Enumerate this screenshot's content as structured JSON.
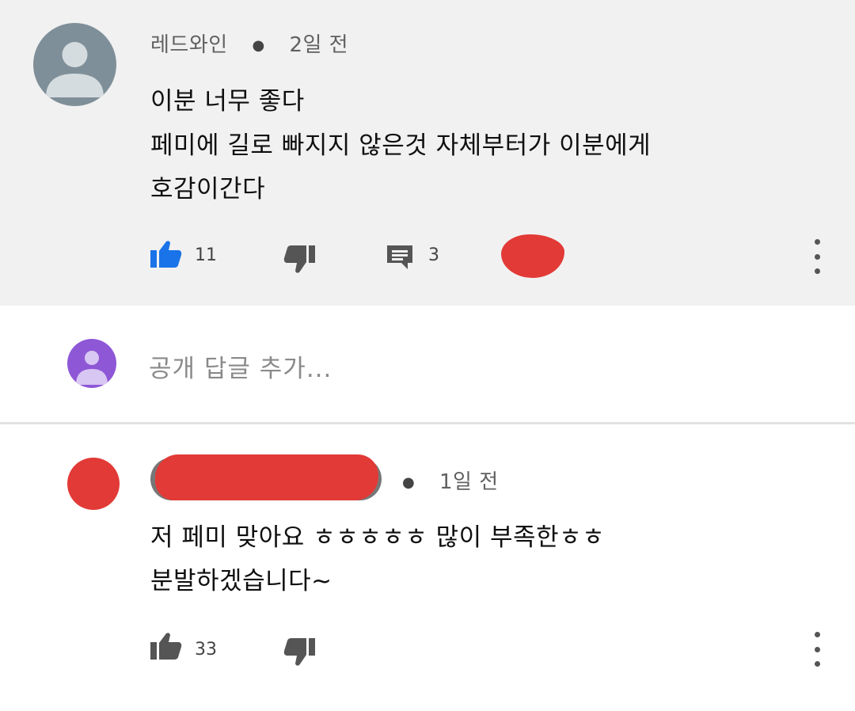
{
  "comments": [
    {
      "author": "레드와인",
      "time": "2일 전",
      "lines": [
        "이분 너무 좋다",
        "페미에 길로 빠지지 않은것 자체부터가 이분에게",
        "호감이간다"
      ],
      "likes": "11",
      "replies": "3",
      "like_active_color": "#1a73e8"
    },
    {
      "author": "",
      "time": "1일 전",
      "lines": [
        "저 페미 맞아요 ㅎㅎㅎㅎㅎ 많이 부족한ㅎㅎ",
        "분발하겠습니다~"
      ],
      "likes": "33"
    }
  ],
  "reply_box": {
    "placeholder": "공개 답글 추가..."
  },
  "colors": {
    "top_background": "#f1f1f1",
    "redaction": "#e23a36",
    "reply_avatar": "#8e57d6"
  },
  "icons": [
    "thumbs-up-icon",
    "thumbs-down-icon",
    "reply-icon",
    "more-vert-icon",
    "avatar-icon"
  ]
}
